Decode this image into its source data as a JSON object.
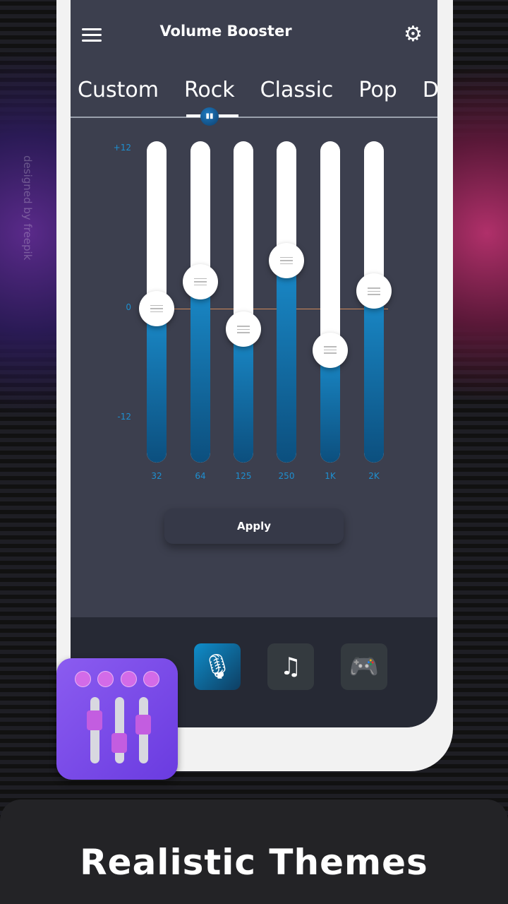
{
  "header": {
    "title": "Volume Booster",
    "menu_icon": "hamburger-icon",
    "settings_icon": "gear-icon"
  },
  "presets": {
    "tabs": [
      "Custom",
      "Rock",
      "Classic",
      "Pop",
      "D"
    ],
    "selected": "Rock"
  },
  "equalizer": {
    "y_labels": {
      "max": "+12",
      "mid": "0",
      "min": "-12"
    },
    "range_db": [
      -12,
      12
    ],
    "bands": [
      {
        "label": "32",
        "value": 0
      },
      {
        "label": "64",
        "value": 2
      },
      {
        "label": "125",
        "value": -2.3
      },
      {
        "label": "250",
        "value": 3.6
      },
      {
        "label": "1K",
        "value": -4.6
      },
      {
        "label": "2K",
        "value": 1.3
      }
    ],
    "fill_color": "#1a8ac9"
  },
  "apply_label": "Apply",
  "modes": [
    {
      "icon": "microphone-icon",
      "active": true
    },
    {
      "icon": "music-note-icon",
      "active": false
    },
    {
      "icon": "gamepad-icon",
      "active": false
    }
  ],
  "watermark": "designed by freepik",
  "caption": "Realistic Themes"
}
